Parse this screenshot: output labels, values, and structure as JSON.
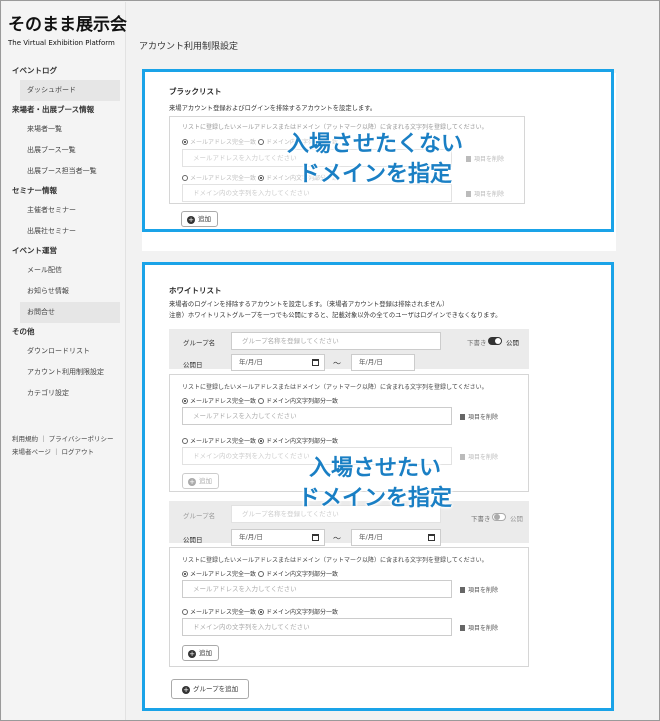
{
  "logo": {
    "main": "そのまま展示会",
    "sub": "The Virtual Exhibition Platform"
  },
  "sidebar": {
    "sections": [
      {
        "title": "イベントログ",
        "items": [
          "ダッシュボード"
        ]
      },
      {
        "title": "来場者・出展ブース情報",
        "items": [
          "来場者一覧",
          "出展ブース一覧",
          "出展ブース担当者一覧"
        ]
      },
      {
        "title": "セミナー情報",
        "items": [
          "主催者セミナー",
          "出展社セミナー"
        ]
      },
      {
        "title": "イベント運営",
        "items": [
          "メール配信",
          "お知らせ情報",
          "お問合せ"
        ]
      },
      {
        "title": "その他",
        "items": [
          "ダウンロードリスト",
          "アカウント利用制限設定",
          "カテゴリ設定"
        ]
      }
    ],
    "footer": {
      "line1": "利用規約 ｜ プライバシーポリシー",
      "line2": "来場者ページ ｜ ログアウト"
    }
  },
  "page": {
    "title": "アカウント利用制限設定"
  },
  "blacklist": {
    "title": "ブラックリスト",
    "desc": "来場アカウント登録およびログインを排除するアカウントを設定します。",
    "hint": "リストに登録したいメールアドレスまたはドメイン（アットマーク以降）に含まれる文字列を登録してください。",
    "radio_exact": "メールアドレス完全一致",
    "radio_partial": "ドメイン内文字列部分一致",
    "email_placeholder": "メールアドレスを入力してください",
    "domain_placeholder": "ドメイン内の文字列を入力してください",
    "delete_label": "項目を削除",
    "add_label": "追加",
    "overlay_line1": "入場させたくない",
    "overlay_line2": "ドメインを指定"
  },
  "whitelist": {
    "title": "ホワイトリスト",
    "desc1": "来場者のログインを排除するアカウントを設定します。（来場者アカウント登録は排除されません）",
    "desc2": "注意）ホワイトリストグループを一つでも公開にすると、記載対象以外の全てのユーザはログインできなくなります。",
    "group_label": "グループ名",
    "group_placeholder": "グループ名称を登録してください",
    "publish_date_label": "公開日",
    "date_placeholder": "年/月/日",
    "tilde": "～",
    "draft_label": "下書き",
    "public_label": "公開",
    "hint": "リストに登録したいメールアドレスまたはドメイン（アットマーク以降）に含まれる文字列を登録してください。",
    "radio_exact": "メールアドレス完全一致",
    "radio_partial": "ドメイン内文字列部分一致",
    "email_placeholder": "メールアドレスを入力してください",
    "domain_placeholder": "ドメイン内の文字列を入力してください",
    "delete_label": "項目を削除",
    "add_label": "追加",
    "add_group_label": "グループを追加",
    "overlay_line1": "入場させたい",
    "overlay_line2": "ドメインを指定"
  }
}
